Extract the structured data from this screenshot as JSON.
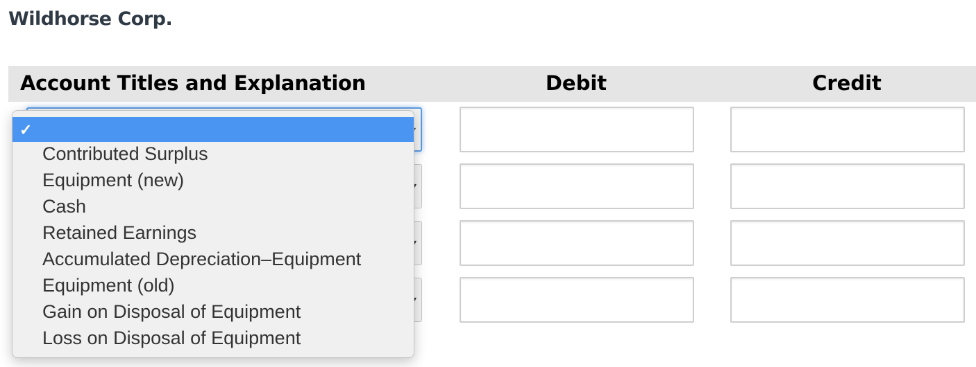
{
  "company": "Wildhorse Corp.",
  "table": {
    "headers": {
      "account": "Account Titles and Explanation",
      "debit": "Debit",
      "credit": "Credit"
    },
    "rows": [
      {
        "account": "",
        "debit": "",
        "credit": ""
      },
      {
        "account": "",
        "debit": "",
        "credit": ""
      },
      {
        "account": "",
        "debit": "",
        "credit": ""
      },
      {
        "account": "",
        "debit": "",
        "credit": ""
      }
    ]
  },
  "dropdown": {
    "selected_index": 0,
    "options": [
      "",
      "Contributed Surplus",
      "Equipment (new)",
      "Cash",
      "Retained Earnings",
      "Accumulated Depreciation–Equipment",
      "Equipment (old)",
      "Gain on Disposal of Equipment",
      "Loss on Disposal of Equipment"
    ],
    "highlight_color": "#4a94f2"
  }
}
